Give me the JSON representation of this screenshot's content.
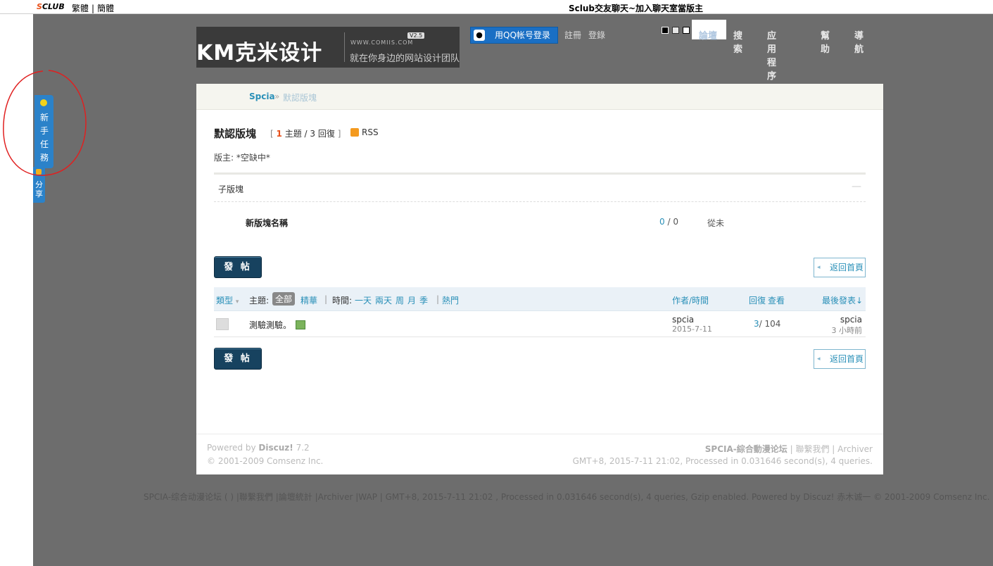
{
  "topbar": {
    "brand_s": "S",
    "brand_club": "CLUB",
    "lang_traditional": "繁體",
    "lang_separator": "|",
    "lang_simplified": "簡體",
    "marquee": "Sclub交友聊天~加入聊天室當版主"
  },
  "header": {
    "logo_main": "KM克米设计",
    "logo_url": "WWW.COMIIS.COM",
    "logo_version": "V2.5",
    "logo_slogan": "就在你身边的网站设计团队",
    "qq_icon": "qq-penguin-icon",
    "qq_login": "用QQ帐号登录",
    "register": "註冊",
    "login": "登錄",
    "style_swatches": [
      "#000000",
      "#ffffff",
      "#ffffff"
    ],
    "nav": [
      "論壇",
      "搜索",
      "应用程序",
      "幫助",
      "導航"
    ]
  },
  "sidebar": {
    "task_label": "新手任務",
    "share_label": "分享"
  },
  "breadcrumb": {
    "home": "Spcia",
    "separator": "»",
    "current": "默認版塊"
  },
  "forum": {
    "title": "默認版塊",
    "stats_open": "[",
    "topics_count": "1",
    "topics_label": "主題 /",
    "replies_count": "3",
    "replies_label": "回復",
    "stats_close": "]",
    "rss": "RSS",
    "moderators": "版主: *空缺中*"
  },
  "subforums": {
    "header": "子版塊",
    "collapse": "—",
    "items": [
      {
        "name": "新版塊名稱",
        "threads": "0",
        "posts": "/ 0",
        "last_post": "從未"
      }
    ]
  },
  "actions": {
    "post_label": "發 帖",
    "back_label": "返回首頁",
    "back_arrow": "◂"
  },
  "thread_header": {
    "type": "類型",
    "type_arrow": "▾",
    "topic": "主題:",
    "all": "全部",
    "digest": "精華",
    "sep1": "|",
    "time": "時間:",
    "one_day": "一天",
    "two_days": "兩天",
    "week": "周",
    "month": "月",
    "season": "季",
    "sep2": "|",
    "hot": "熱門",
    "author_time": "作者/時間",
    "replies": "回復",
    "views": "查看",
    "last_post": "最後發表",
    "last_post_arrow": "↓"
  },
  "threads": [
    {
      "title": "測驗測驗。",
      "author": "spcia",
      "date": "2015-7-11",
      "replies": "3",
      "views": "/ 104",
      "last_user": "spcia",
      "last_time": "3 小時前"
    }
  ],
  "footer": {
    "powered_prefix": "Powered by",
    "powered_name": "Discuz!",
    "powered_version": "7.2",
    "copyright": "© 2001-2009 Comsenz Inc.",
    "site_name": "SPCIA-綜合動漫论坛",
    "sep": "|",
    "contact": "聯繫我們",
    "archiver": "Archiver",
    "stats": "GMT+8, 2015-7-11 21:02, Processed in 0.031646 second(s), 4 queries."
  },
  "bottom_line": "SPCIA-综合动漫论坛 ( ) |聯繫我們 |論壇統計 |Archiver |WAP | GMT+8, 2015-7-11 21:02 , Processed in 0.031646 second(s), 4 queries, Gzip enabled. Powered by Discuz! 赤木诚一 © 2001-2009 Comsenz Inc.",
  "colors": {
    "link_blue": "#2a90b8",
    "accent_orange": "#e8501a",
    "canvas_grey": "#6d6d6d",
    "button_navy": "#17425f",
    "annotation_red": "#e02020"
  }
}
